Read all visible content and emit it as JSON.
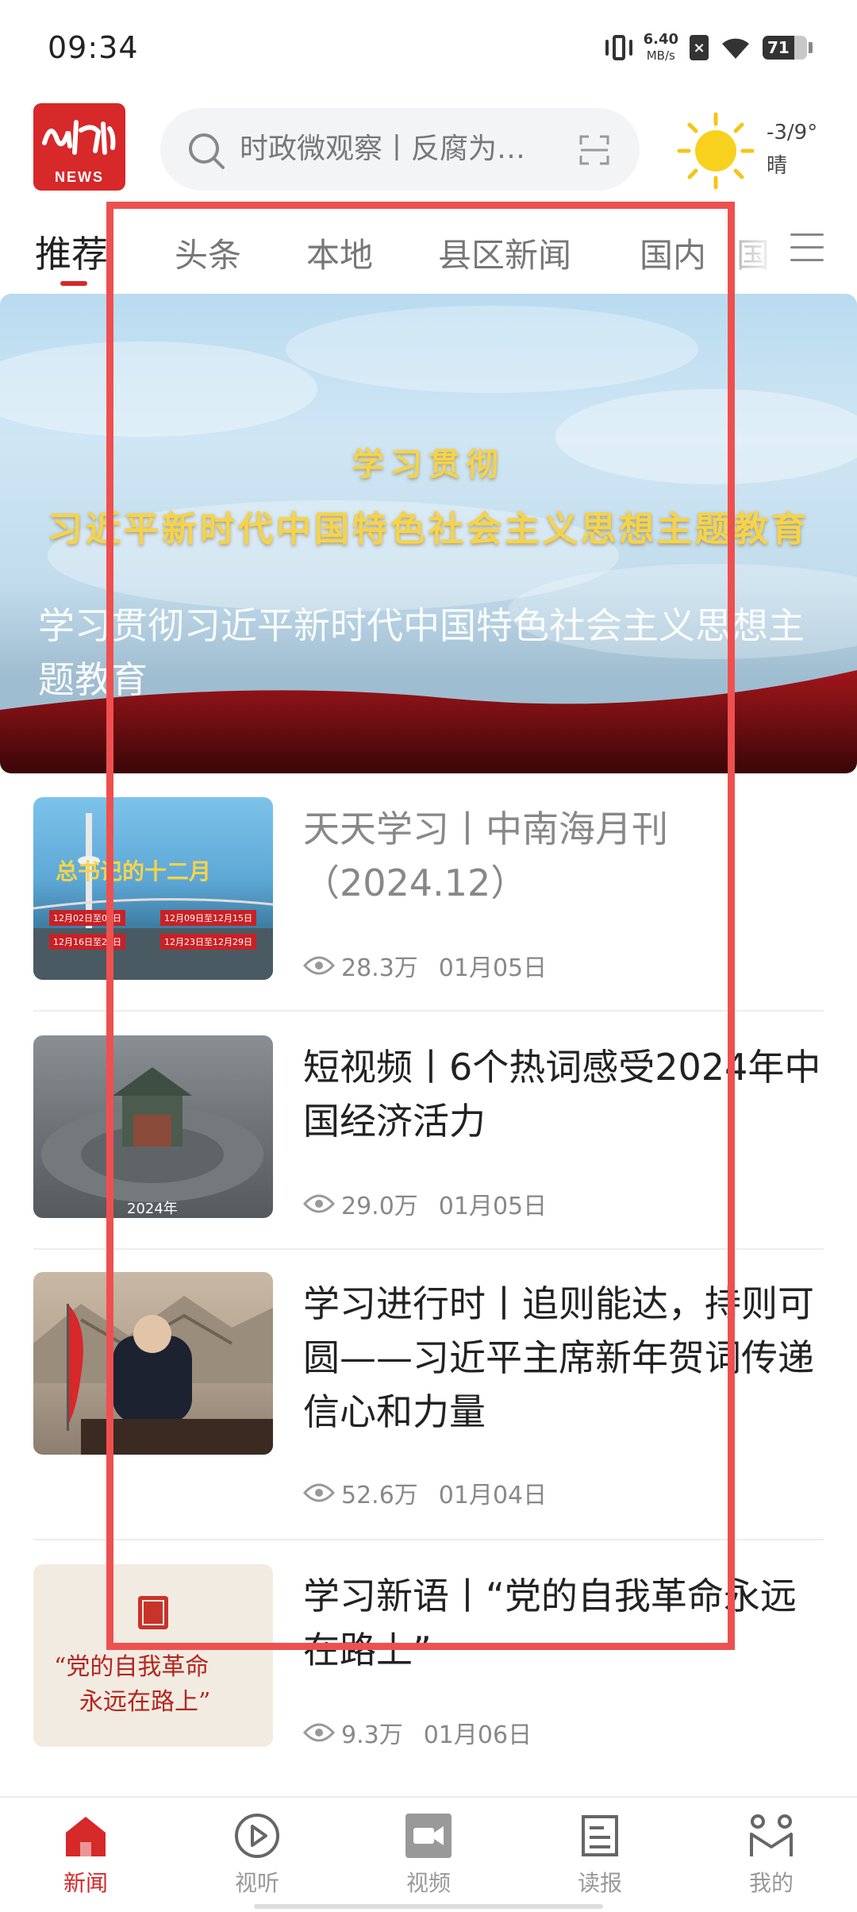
{
  "status_bar": {
    "time": "09:34",
    "net_speed": "6.40",
    "net_unit": "MB/s",
    "battery": "71",
    "battery_level_pct": 71
  },
  "header": {
    "logo_text": "NEWS",
    "search_placeholder": "时政微观察丨反腐为…",
    "weather": {
      "temp": "-3/9°",
      "condition": "晴"
    }
  },
  "tabs": [
    {
      "label": "推荐",
      "active": true
    },
    {
      "label": "头条"
    },
    {
      "label": "本地"
    },
    {
      "label": "县区新闻"
    },
    {
      "label": "国内"
    },
    {
      "label": "国"
    }
  ],
  "banner": {
    "headline_line1": "学习贯彻",
    "headline_line2": "习近平新时代中国特色社会主义思想主题教育",
    "title": "学习贯彻习近平新时代中国特色社会主义思想主题教育"
  },
  "news": [
    {
      "title": "天天学习丨中南海月刊（2024.12）",
      "views": "28.3万",
      "date": "01月05日",
      "read": true,
      "thumb_text": "总书记的十二月",
      "thumb_tags": [
        "12月02日至08日",
        "12月09日至12月15日",
        "12月16日至22日",
        "12月23日至12月29日"
      ]
    },
    {
      "title": "短视频丨6个热词感受2024年中国经济活力",
      "views": "29.0万",
      "date": "01月05日",
      "read": false,
      "thumb_text": "2024年"
    },
    {
      "title": "学习进行时丨追则能达，持则可圆——习近平主席新年贺词传递信心和力量",
      "views": "52.6万",
      "date": "01月04日",
      "read": false
    },
    {
      "title": "学习新语丨“党的自我革命永远在路上”",
      "views": "9.3万",
      "date": "01月06日",
      "read": false,
      "thumb_line1": "“党的自我革命",
      "thumb_line2": "永远在路上”"
    }
  ],
  "bottom_nav": [
    {
      "label": "新闻",
      "icon": "home-icon",
      "active": true
    },
    {
      "label": "视听",
      "icon": "play-icon"
    },
    {
      "label": "视频",
      "icon": "video-icon"
    },
    {
      "label": "读报",
      "icon": "newspaper-icon"
    },
    {
      "label": "我的",
      "icon": "profile-icon"
    }
  ],
  "colors": {
    "brand_red": "#d7282a",
    "selection_box": "#ee5050"
  }
}
